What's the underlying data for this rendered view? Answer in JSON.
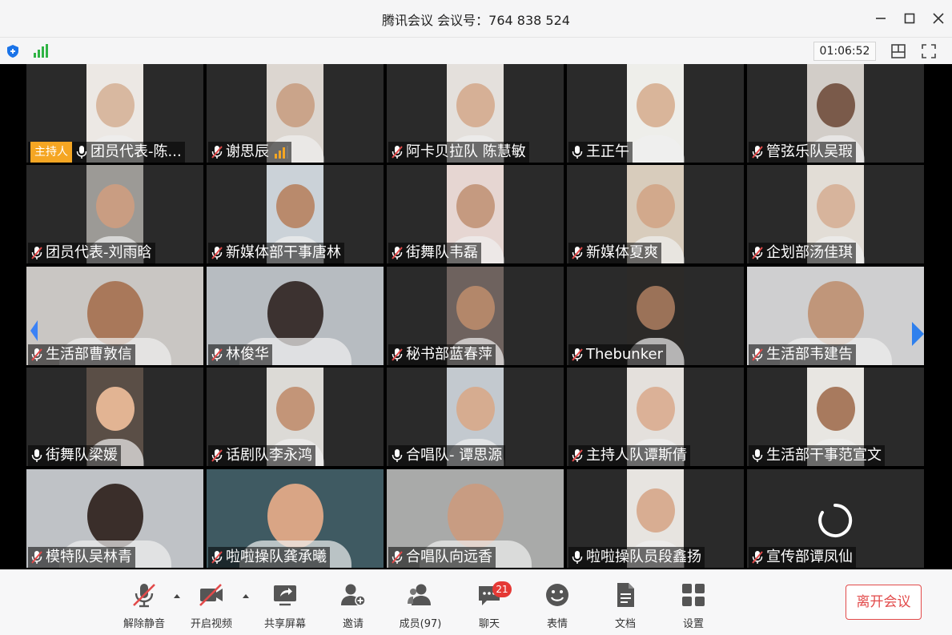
{
  "window": {
    "title": "腾讯会议 会议号：764 838 524"
  },
  "subbar": {
    "timer": "01:06:52"
  },
  "host_badge": "主持人",
  "participants": [
    {
      "name": "团员代表-陈...",
      "host": true,
      "muted": false,
      "frame": "narrow",
      "bg": "#ece8e4",
      "face": "#d8b8a0"
    },
    {
      "name": "谢思辰",
      "muted": true,
      "speaking": true,
      "frame": "narrow",
      "bg": "#dcd6d0",
      "face": "#caa48a"
    },
    {
      "name": "阿卡贝拉队 陈慧敏",
      "muted": true,
      "frame": "narrow",
      "bg": "#e4e0dc",
      "face": "#d6b096"
    },
    {
      "name": "王正午",
      "muted": false,
      "frame": "narrow",
      "bg": "#eeeeea",
      "face": "#d9b59a"
    },
    {
      "name": "管弦乐队吴瑕",
      "muted": true,
      "frame": "narrow",
      "bg": "#d2cdc8",
      "face": "#7a5a4a"
    },
    {
      "name": "团员代表-刘雨晗",
      "muted": true,
      "frame": "narrow",
      "bg": "#9c9a96",
      "face": "#c99d82"
    },
    {
      "name": "新媒体部干事唐林",
      "muted": true,
      "frame": "narrow",
      "bg": "#cbd2d8",
      "face": "#b98a6c"
    },
    {
      "name": "街舞队韦磊",
      "muted": true,
      "frame": "narrow",
      "bg": "#e6d6d2",
      "face": "#c59a80"
    },
    {
      "name": "新媒体夏爽",
      "muted": true,
      "frame": "narrow",
      "bg": "#d8ccbc",
      "face": "#d2a98c"
    },
    {
      "name": "企划部汤佳琪",
      "muted": true,
      "frame": "narrow",
      "bg": "#e2ddd6",
      "face": "#d7b49c"
    },
    {
      "name": "生活部曹敦信",
      "muted": true,
      "frame": "wide",
      "bg": "#c9c6c3",
      "face": "#a9785a"
    },
    {
      "name": "林俊华",
      "muted": true,
      "frame": "wide",
      "bg": "#b7bcc1",
      "face": "#3c3230"
    },
    {
      "name": "秘书部蓝春萍",
      "muted": true,
      "frame": "narrow",
      "bg": "#6e625e",
      "face": "#b3876a"
    },
    {
      "name": "Thebunker",
      "muted": true,
      "frame": "narrow",
      "bg": "#2c2a28",
      "face": "#9b7258"
    },
    {
      "name": "生活部韦建告",
      "muted": true,
      "frame": "wide",
      "bg": "#cfcfd0",
      "face": "#c0967a"
    },
    {
      "name": "街舞队梁媛",
      "muted": false,
      "frame": "narrow",
      "bg": "#5a4e46",
      "face": "#e2b493"
    },
    {
      "name": "话剧队李永鸿",
      "muted": true,
      "frame": "narrow",
      "bg": "#dcdad6",
      "face": "#c39578"
    },
    {
      "name": "合唱队- 谭思源",
      "muted": false,
      "frame": "narrow",
      "bg": "#c3c9cf",
      "face": "#d6ac90"
    },
    {
      "name": "主持人队谭斯倩",
      "muted": true,
      "frame": "narrow",
      "bg": "#e4e0dc",
      "face": "#dbb197"
    },
    {
      "name": "生活部干事范宣文",
      "muted": false,
      "frame": "narrow",
      "bg": "#e8e6e2",
      "face": "#a87a5e"
    },
    {
      "name": "模特队吴林青",
      "muted": true,
      "frame": "wide",
      "bg": "#bfc2c6",
      "face": "#3a2e2a"
    },
    {
      "name": "啦啦操队龚承曦",
      "muted": true,
      "frame": "wide",
      "bg": "#3f5a62",
      "face": "#d9a585"
    },
    {
      "name": "合唱队向远香",
      "muted": true,
      "frame": "wide",
      "bg": "#a9aaa9",
      "face": "#c89c82"
    },
    {
      "name": "啦啦操队员段鑫扬",
      "muted": false,
      "frame": "narrow",
      "bg": "#e7e4e0",
      "face": "#d8ad92"
    },
    {
      "name": "宣传部谭凤仙",
      "muted": true,
      "frame": "none",
      "bg": "#2a2a2a",
      "face": "#2a2a2a",
      "loading": true
    }
  ],
  "toolbar": {
    "unmute": "解除静音",
    "start_video": "开启视频",
    "share_screen": "共享屏幕",
    "invite": "邀请",
    "members": "成员(97)",
    "chat": "聊天",
    "chat_badge": "21",
    "reactions": "表情",
    "documents": "文档",
    "settings": "设置",
    "leave": "离开会议"
  },
  "colors": {
    "accent": "#1a73e8",
    "muted_icon": "#e24a4a",
    "leave_red": "#e24a4a",
    "host_badge": "#f5a623",
    "badge_red": "#e53935"
  }
}
